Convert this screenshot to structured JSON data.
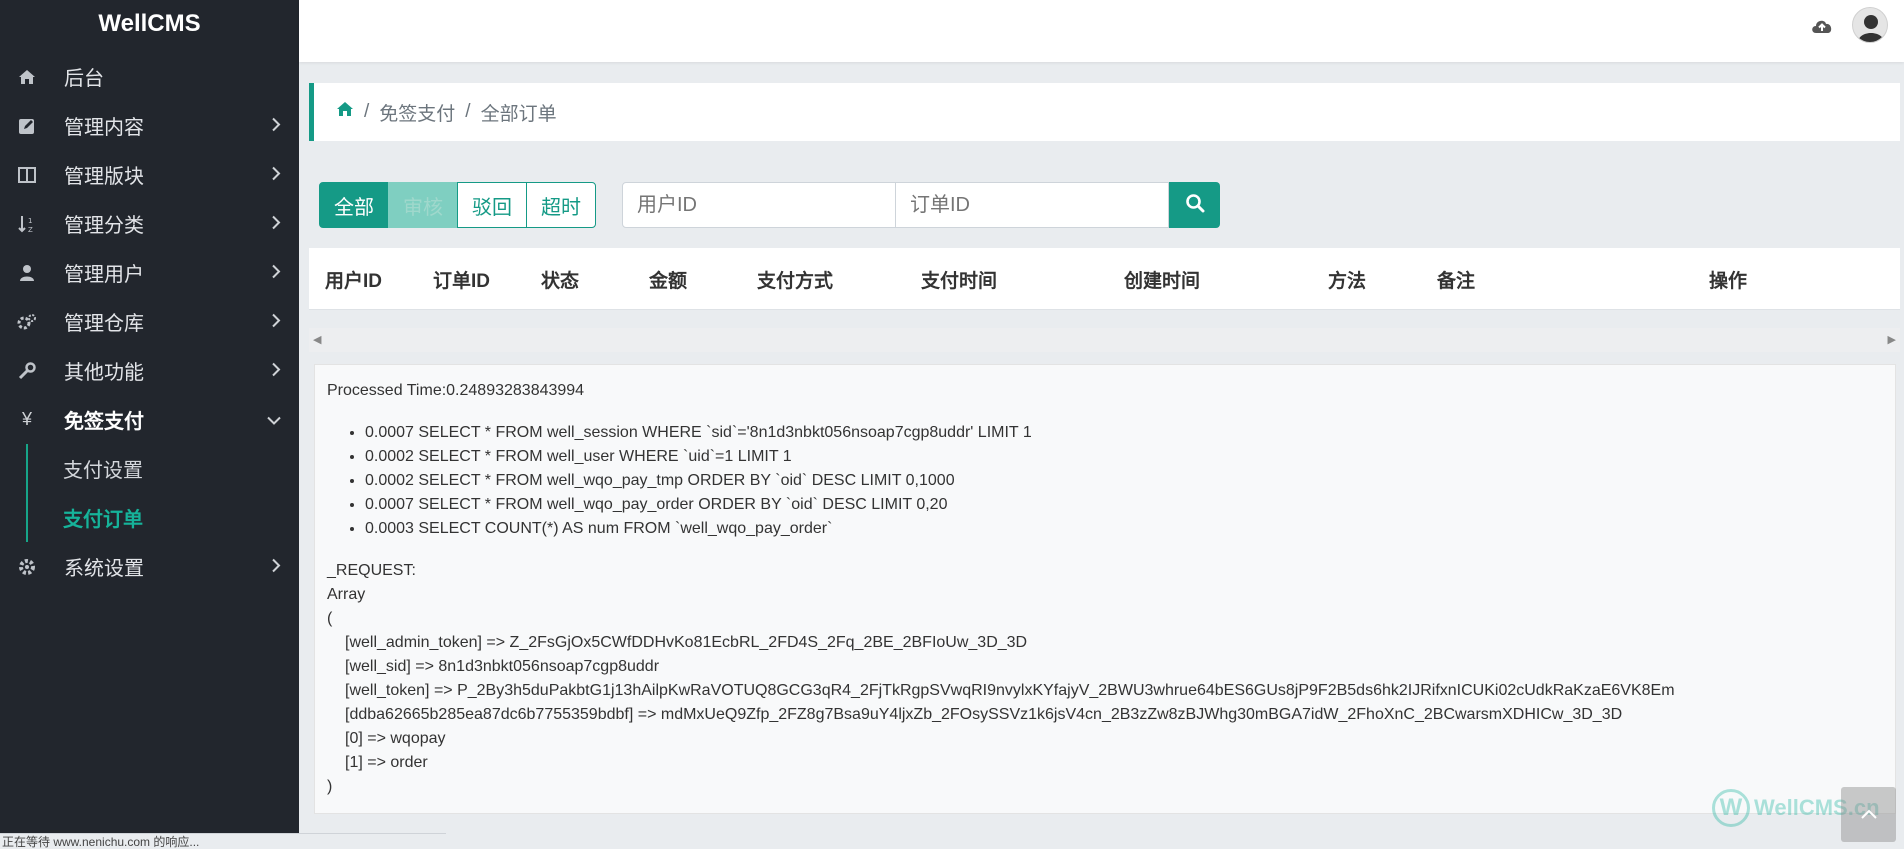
{
  "brand": "WellCMS",
  "sidebar": {
    "items": [
      {
        "label": "后台",
        "icon": "home-icon"
      },
      {
        "label": "管理内容",
        "icon": "edit-icon"
      },
      {
        "label": "管理版块",
        "icon": "columns-icon"
      },
      {
        "label": "管理分类",
        "icon": "sort-icon"
      },
      {
        "label": "管理用户",
        "icon": "user-icon"
      },
      {
        "label": "管理仓库",
        "icon": "gears-icon"
      },
      {
        "label": "其他功能",
        "icon": "wrench-icon"
      },
      {
        "label": "免签支付",
        "icon": "yen-icon",
        "glyph": "¥"
      },
      {
        "label": "系统设置",
        "icon": "gear-icon"
      }
    ],
    "sub_items": [
      {
        "label": "支付设置"
      },
      {
        "label": "支付订单"
      }
    ]
  },
  "breadcrumb": {
    "items": [
      "免签支付",
      "全部订单"
    ],
    "sep": "/"
  },
  "filters": {
    "buttons": [
      "全部",
      "审核",
      "驳回",
      "超时"
    ]
  },
  "search": {
    "user_placeholder": "用户ID",
    "order_placeholder": "订单ID"
  },
  "table": {
    "columns": [
      "用户ID",
      "订单ID",
      "状态",
      "金额",
      "支付方式",
      "支付时间",
      "创建时间",
      "方法",
      "备注",
      "操作"
    ]
  },
  "debug": {
    "processed_time": "Processed Time:0.24893283843994",
    "queries": [
      "0.0007 SELECT * FROM well_session WHERE `sid`='8n1d3nbkt056nsoap7cgp8uddr' LIMIT 1",
      "0.0002 SELECT * FROM well_user WHERE `uid`=1 LIMIT 1",
      "0.0002 SELECT * FROM well_wqo_pay_tmp ORDER BY `oid` DESC LIMIT 0,1000",
      "0.0007 SELECT * FROM well_wqo_pay_order ORDER BY `oid` DESC LIMIT 0,20",
      "0.0003 SELECT COUNT(*) AS num FROM `well_wqo_pay_order`"
    ],
    "request_label": "_REQUEST:",
    "array_label": "Array",
    "open_paren": "(",
    "entries": [
      "[well_admin_token] => Z_2FsGjOx5CWfDDHvKo81EcbRL_2FD4S_2Fq_2BE_2BFIoUw_3D_3D",
      "[well_sid] => 8n1d3nbkt056nsoap7cgp8uddr",
      "[well_token] => P_2By3h5duPakbtG1j13hAilpKwRaVOTUQ8GCG3qR4_2FjTkRgpSVwqRI9nvylxKYfajyV_2BWU3whrue64bES6GUs8jP9F2B5ds6hk2IJRifxnICUKi02cUdkRaKzaE6VK8Em",
      "[ddba62665b285ea87dc6b7755359bdbf] => mdMxUeQ9Zfp_2FZ8g7Bsa9uY4ljxZb_2FOsySSVz1k6jsV4cn_2B3zZw8zBJWhg30mBGA7idW_2FhoXnC_2BCwarsmXDHICw_3D_3D",
      "[0] => wqopay",
      "[1] => order"
    ],
    "close_paren": ")"
  },
  "watermark": "WellCMS.cn",
  "status_bar": "正在等待 www.nenichu.com 的响应..."
}
